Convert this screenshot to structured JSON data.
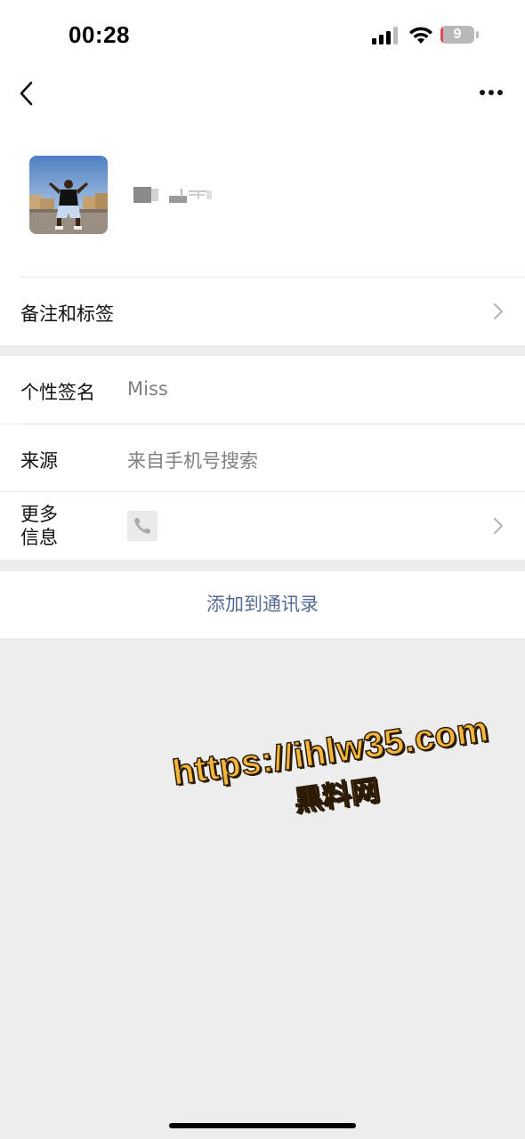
{
  "status_bar": {
    "time": "00:28",
    "battery_level": "9",
    "battery_fraction": 0.09,
    "icons": [
      "cellular-signal-icon",
      "wifi-icon",
      "battery-icon"
    ]
  },
  "nav": {
    "icons": [
      "chevron-left-icon",
      "more-dots-icon"
    ]
  },
  "profile": {
    "avatar": "photo of a person posing outdoors",
    "nickname": ""
  },
  "remark_row": {
    "label": "备注和标签"
  },
  "signature_row": {
    "label": "个性签名",
    "value": "Miss"
  },
  "source_row": {
    "label": "来源",
    "value": "来自手机号搜索"
  },
  "more_info_row": {
    "label_line1": "更多",
    "label_line2": "信息",
    "icon": "phone-icon"
  },
  "add_contact": {
    "label": "添加到通讯录"
  },
  "watermark": {
    "line1": "https://ihlw35.com",
    "line2": "黑料网"
  },
  "colors": {
    "background": "#ededed",
    "link": "#576b95",
    "secondary_text": "#808080",
    "battery_low": "#e5484d"
  }
}
